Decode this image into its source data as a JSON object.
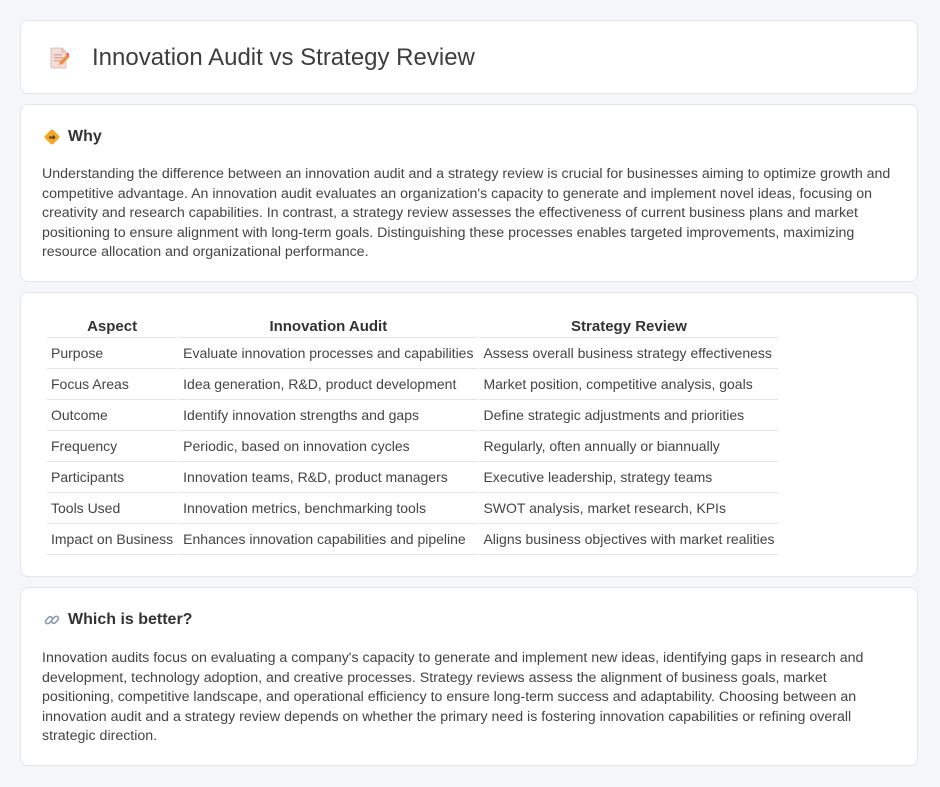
{
  "header": {
    "title": "Innovation Audit vs Strategy Review",
    "icon": "document-pencil-icon"
  },
  "why": {
    "heading": "Why",
    "icon": "diamond-direction-icon",
    "text": "Understanding the difference between an innovation audit and a strategy review is crucial for businesses aiming to optimize growth and competitive advantage. An innovation audit evaluates an organization's capacity to generate and implement novel ideas, focusing on creativity and research capabilities. In contrast, a strategy review assesses the effectiveness of current business plans and market positioning to ensure alignment with long-term goals. Distinguishing these processes enables targeted improvements, maximizing resource allocation and organizational performance."
  },
  "table": {
    "headers": [
      "Aspect",
      "Innovation Audit",
      "Strategy Review"
    ],
    "rows": [
      [
        "Purpose",
        "Evaluate innovation processes and capabilities",
        "Assess overall business strategy effectiveness"
      ],
      [
        "Focus Areas",
        "Idea generation, R&D, product development",
        "Market position, competitive analysis, goals"
      ],
      [
        "Outcome",
        "Identify innovation strengths and gaps",
        "Define strategic adjustments and priorities"
      ],
      [
        "Frequency",
        "Periodic, based on innovation cycles",
        "Regularly, often annually or biannually"
      ],
      [
        "Participants",
        "Innovation teams, R&D, product managers",
        "Executive leadership, strategy teams"
      ],
      [
        "Tools Used",
        "Innovation metrics, benchmarking tools",
        "SWOT analysis, market research, KPIs"
      ],
      [
        "Impact on Business",
        "Enhances innovation capabilities and pipeline",
        "Aligns business objectives with market realities"
      ]
    ]
  },
  "better": {
    "heading": "Which is better?",
    "icon": "link-icon",
    "text": "Innovation audits focus on evaluating a company's capacity to generate and implement new ideas, identifying gaps in research and development, technology adoption, and creative processes. Strategy reviews assess the alignment of business goals, market positioning, competitive landscape, and operational efficiency to ensure long-term success and adaptability. Choosing between an innovation audit and a strategy review depends on whether the primary need is fostering innovation capabilities or refining overall strategic direction."
  }
}
